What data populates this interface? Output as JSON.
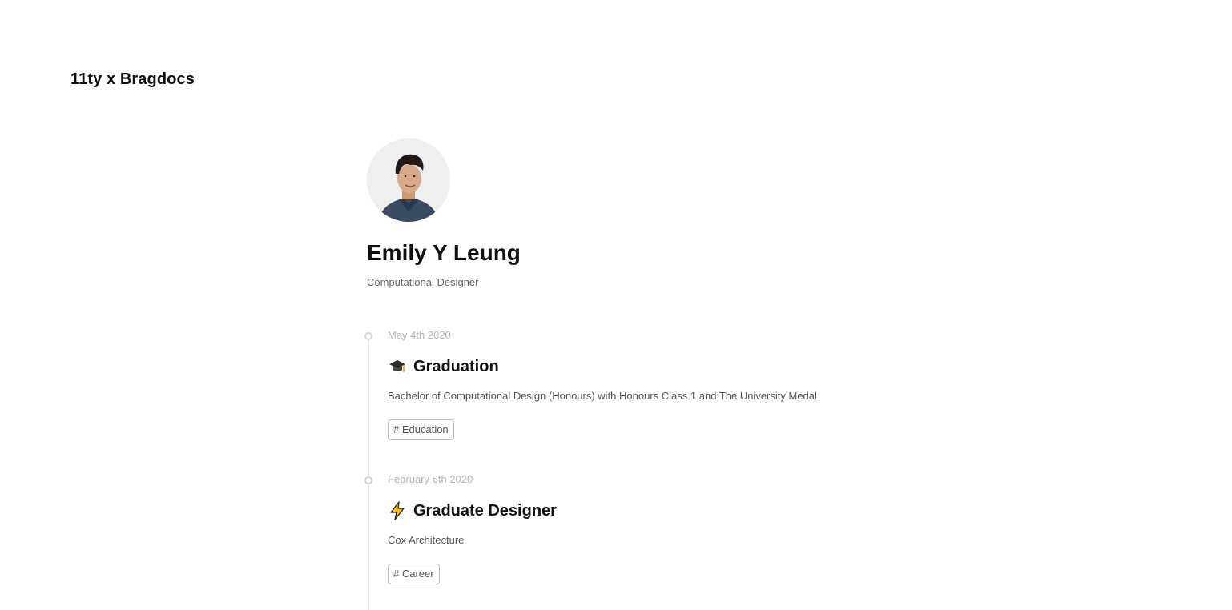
{
  "header": {
    "site_title": "11ty x Bragdocs"
  },
  "profile": {
    "name": "Emily Y Leung",
    "role": "Computational Designer"
  },
  "timeline": {
    "entries": [
      {
        "date": "May 4th 2020",
        "icon": "graduation-cap-icon",
        "title": "Graduation",
        "description": "Bachelor of Computational Design (Honours) with Honours Class 1 and The University Medal",
        "tag": "# Education"
      },
      {
        "date": "February 6th 2020",
        "icon": "lightning-bolt-icon",
        "title": "Graduate Designer",
        "description": "Cox Architecture",
        "tag": "# Career"
      }
    ]
  },
  "colors": {
    "text": "#111111",
    "muted": "#666666",
    "date": "#b5b5b5",
    "timeline_line": "#e6e6e6",
    "tag_border": "#bdbdbd",
    "bolt_yellow": "#f5c518"
  }
}
